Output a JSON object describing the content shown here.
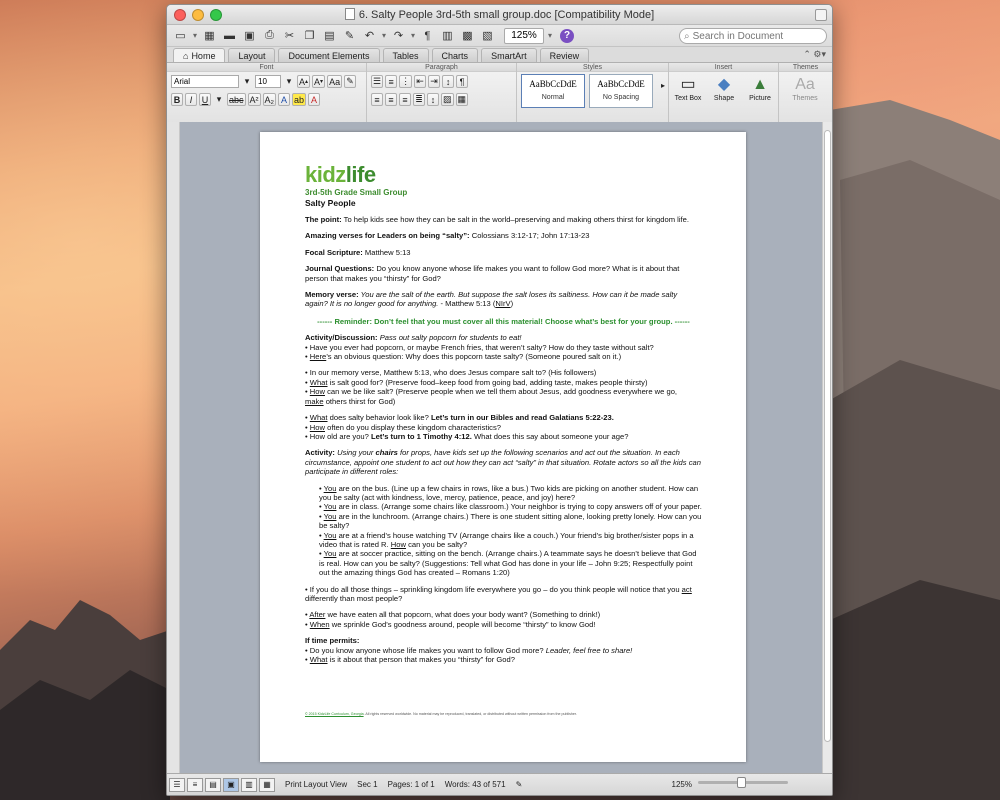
{
  "window": {
    "title": "6. Salty People 3rd-5th small group.doc [Compatibility Mode]"
  },
  "standard_toolbar": {
    "zoom": "125%",
    "search_placeholder": "Search in Document",
    "help": "?"
  },
  "tabs": [
    "Home",
    "Layout",
    "Document Elements",
    "Tables",
    "Charts",
    "SmartArt",
    "Review"
  ],
  "ribbon": {
    "groups": {
      "font": "Font",
      "paragraph": "Paragraph",
      "styles": "Styles",
      "insert": "Insert",
      "themes": "Themes"
    },
    "font_name": "Arial",
    "font_size": "10",
    "styles": [
      {
        "preview": "AaBbCcDdE",
        "name": "Normal"
      },
      {
        "preview": "AaBbCcDdE",
        "name": "No Spacing"
      }
    ],
    "insert": [
      "Text Box",
      "Shape",
      "Picture"
    ],
    "themes_label": "Themes"
  },
  "doc": {
    "logo_a": "kidz",
    "logo_b": "life",
    "subtitle": "3rd-5th Grade Small Group",
    "heading": "Salty People",
    "point_label": "The point:",
    "point_text": " To help kids see how they can be salt in the world–preserving and making others thirst for kingdom life.",
    "verses_label": "Amazing verses for Leaders on being “salty”:",
    "verses_text": " Colossians 3:12-17; John 17:13-23",
    "focal_label": "Focal Scripture:",
    "focal_text": " Matthew 5:13",
    "journal_label": "Journal Questions:",
    "journal_text": " Do you know anyone whose life makes you want to follow God more? What is it about that person that makes you “thirsty” for God?",
    "memory_label": "Memory verse:",
    "memory_text": " You are the salt of the earth. But suppose the salt loses its saltiness. How can it be made salty again? It is no longer good for anything.",
    "memory_ref": " - Matthew 5:13 (",
    "memory_ver": "NIrV",
    "memory_close": ")",
    "reminder": "------ Reminder: Don’t feel that you must cover all this material! Choose what’s best for your group. ------",
    "activity_label": "Activity/Discussion:",
    "activity_text": " Pass out salty popcorn for students to eat!",
    "d1": "• Have you ever had popcorn, or maybe French fries, that weren’t salty? How do they taste without salt?",
    "d2a": "• ",
    "d2b": "Here",
    "d2c": "’s an obvious question: Why does this popcorn taste salty? (Someone poured salt on it.)",
    "d3": "• In our memory verse, Matthew 5:13, who does Jesus compare salt to? (His followers)",
    "d4a": "• ",
    "d4b": "What",
    "d4c": " is salt good for? (Preserve food–keep food from going bad, adding taste, makes people thirsty)",
    "d5a": "• ",
    "d5b": "How",
    "d5c": " can we be like salt? (Preserve people when we tell them about Jesus, add goodness everywhere we go,",
    "d5d": "make",
    "d5e": " others thirst for God)",
    "d6a": "• ",
    "d6b": "What",
    "d6c": " does salty behavior look like? ",
    "d6d": "Let’s turn in our Bibles and read Galatians 5:22-23.",
    "d7a": "• ",
    "d7b": "How",
    "d7c": " often do you display these kingdom characteristics?",
    "d8a": "• How old are you? ",
    "d8b": "Let’s turn to 1 Timothy 4:12.",
    "d8c": " What does this say about someone your age?",
    "act2_label": "Activity:",
    "act2_pre": " Using your ",
    "act2_chairs": "chairs",
    "act2_text": " for props, have kids set up the following scenarios and act out the situation. In each circumstance, appoint one student to act out how they can act “salty” in that situation. Rotate actors so all the kids can participate in different roles:",
    "s1a": "• ",
    "s1b": "You",
    "s1c": " are on the bus. (Line up a few chairs in rows, like a bus.) Two kids are picking on another student. How can you be salty (act with kindness, love, mercy, patience, peace, and joy) here?",
    "s2a": "• ",
    "s2b": "You",
    "s2c": " are in class. (Arrange some chairs like classroom.) Your neighbor is trying to copy answers off of your paper.",
    "s3a": "• ",
    "s3b": "You",
    "s3c": " are in the lunchroom. (Arrange chairs.) There is one student sitting alone, looking pretty lonely. How can you be salty?",
    "s4a": "• ",
    "s4b": "You",
    "s4c": " are at a friend’s house watching TV (Arrange chairs like a couch.) Your friend’s big brother/sister pops in a video that is rated R. ",
    "s4d": "How",
    "s4e": " can you be salty?",
    "s5a": "• ",
    "s5b": "You",
    "s5c": " are at soccer practice, sitting on the bench. (Arrange chairs.) A teammate says he doesn’t believe that God is real. How can you be salty? (Suggestions: Tell what God has done in your life – John 9:25; Respectfully point out the amazing things God has created – Romans 1:20)",
    "e1a": "• If you do all those things – sprinkling kingdom life everywhere you go – do you think people will notice that you ",
    "e1b": "act",
    "e1c": " differently than most people?",
    "e2a": "• ",
    "e2b": "After",
    "e2c": " we have eaten all that popcorn, what does your body want? (Something to drink!)",
    "e3a": "• ",
    "e3b": "When",
    "e3c": " we sprinkle God’s goodness around, people will become “thirsty” to know God!",
    "time_label": "If time permits:",
    "t1a": "• Do you know anyone whose life makes you want to follow God more? ",
    "t1b": "Leader, feel free to share!",
    "t2a": "• ",
    "t2b": "What",
    "t2c": " is it about that person that makes you “thirsty” for God?",
    "footer_a": "© 2015 KidzLife Curriculum, Georgia",
    "footer_b": ". All rights reserved worldwide. No material may be reproduced, translated, or distributed without written permission from the publisher."
  },
  "status": {
    "view": "Print Layout View",
    "sec_label": "Sec",
    "sec": "1",
    "pages_label": "Pages:",
    "pages": "1 of 1",
    "words_label": "Words:",
    "words": "43 of 571",
    "zoom": "125%"
  },
  "colors": {
    "accent": "#3d8c2f",
    "reminder": "#2c8f2f",
    "help": "#7a4fc2"
  }
}
